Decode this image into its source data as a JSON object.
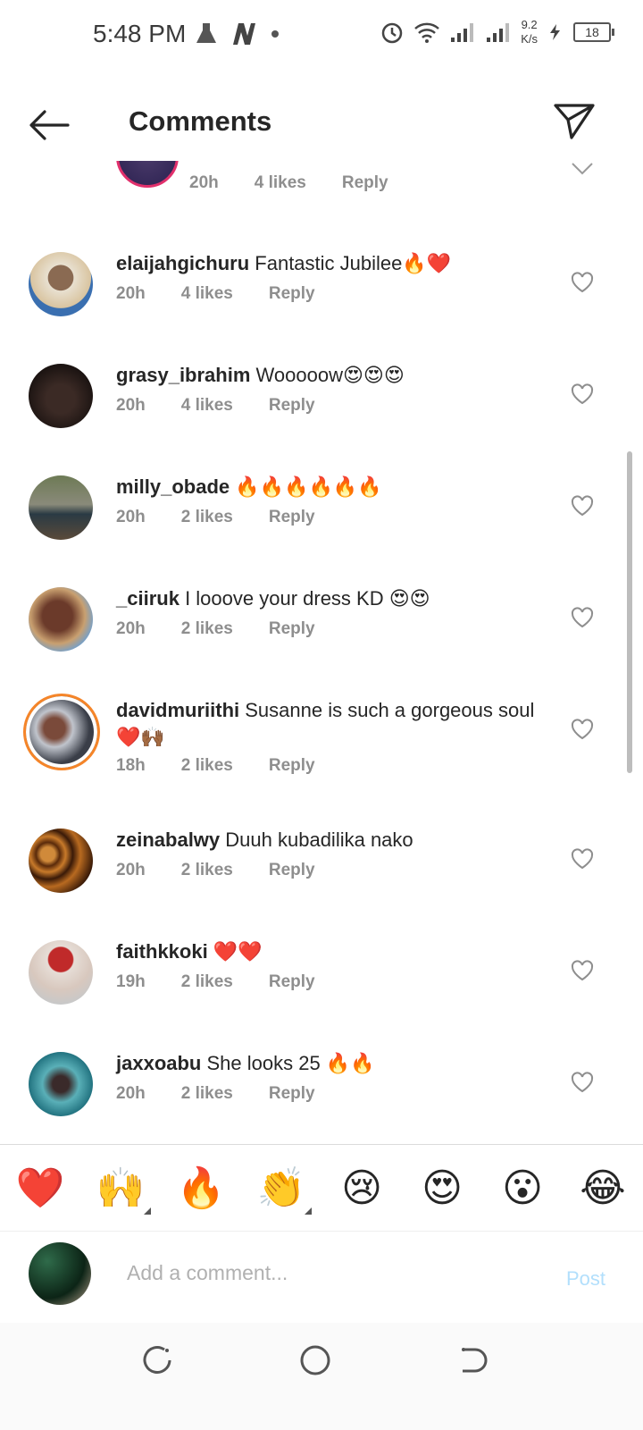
{
  "status_bar": {
    "time": "5:48 PM",
    "speed_value": "9.2",
    "speed_unit": "K/s",
    "battery": "18"
  },
  "header": {
    "title": "Comments",
    "back_icon": "arrow-left-icon",
    "share_icon": "paper-plane-icon"
  },
  "partial_item": {
    "time": "20h",
    "likes": "4 likes",
    "reply": "Reply"
  },
  "comments": [
    {
      "username": "elaijahgichuru",
      "text": "Fantastic Jubilee🔥❤️",
      "time": "20h",
      "likes": "4 likes",
      "reply": "Reply",
      "avatar_color": "#d9c4a0"
    },
    {
      "username": "grasy_ibrahim",
      "text": "Wooooow😍😍😍",
      "time": "20h",
      "likes": "4 likes",
      "reply": "Reply",
      "avatar_color": "#2a1f1c"
    },
    {
      "username": "milly_obade",
      "text": "🔥🔥🔥🔥🔥🔥",
      "time": "20h",
      "likes": "2 likes",
      "reply": "Reply",
      "avatar_color": "#3c4a52"
    },
    {
      "username": "_ciiruk",
      "text": "I looove your dress KD 😍😍",
      "time": "20h",
      "likes": "2 likes",
      "reply": "Reply",
      "avatar_color": "#6b3a2a"
    },
    {
      "username": "davidmuriithi",
      "text": "Susanne is such a gorgeous soul ❤️🙌🏾",
      "time": "18h",
      "likes": "2 likes",
      "reply": "Reply",
      "avatar_color": "#8a8f99"
    },
    {
      "username": "zeinabalwy",
      "text": "Duuh kubadilika nako",
      "time": "20h",
      "likes": "2 likes",
      "reply": "Reply",
      "avatar_color": "#b5651d"
    },
    {
      "username": "faithkkoki",
      "text": "❤️❤️",
      "time": "19h",
      "likes": "2 likes",
      "reply": "Reply",
      "avatar_color": "#c8a89a"
    },
    {
      "username": "jaxxoabu",
      "text": "She looks 25 🔥🔥",
      "time": "20h",
      "likes": "2 likes",
      "reply": "Reply",
      "avatar_color": "#2e8f9a"
    }
  ],
  "emoji_bar": [
    "❤️",
    "🙌",
    "🔥",
    "👏",
    "😢",
    "😍",
    "😮",
    "😂"
  ],
  "composer": {
    "placeholder": "Add a comment...",
    "post_label": "Post"
  }
}
